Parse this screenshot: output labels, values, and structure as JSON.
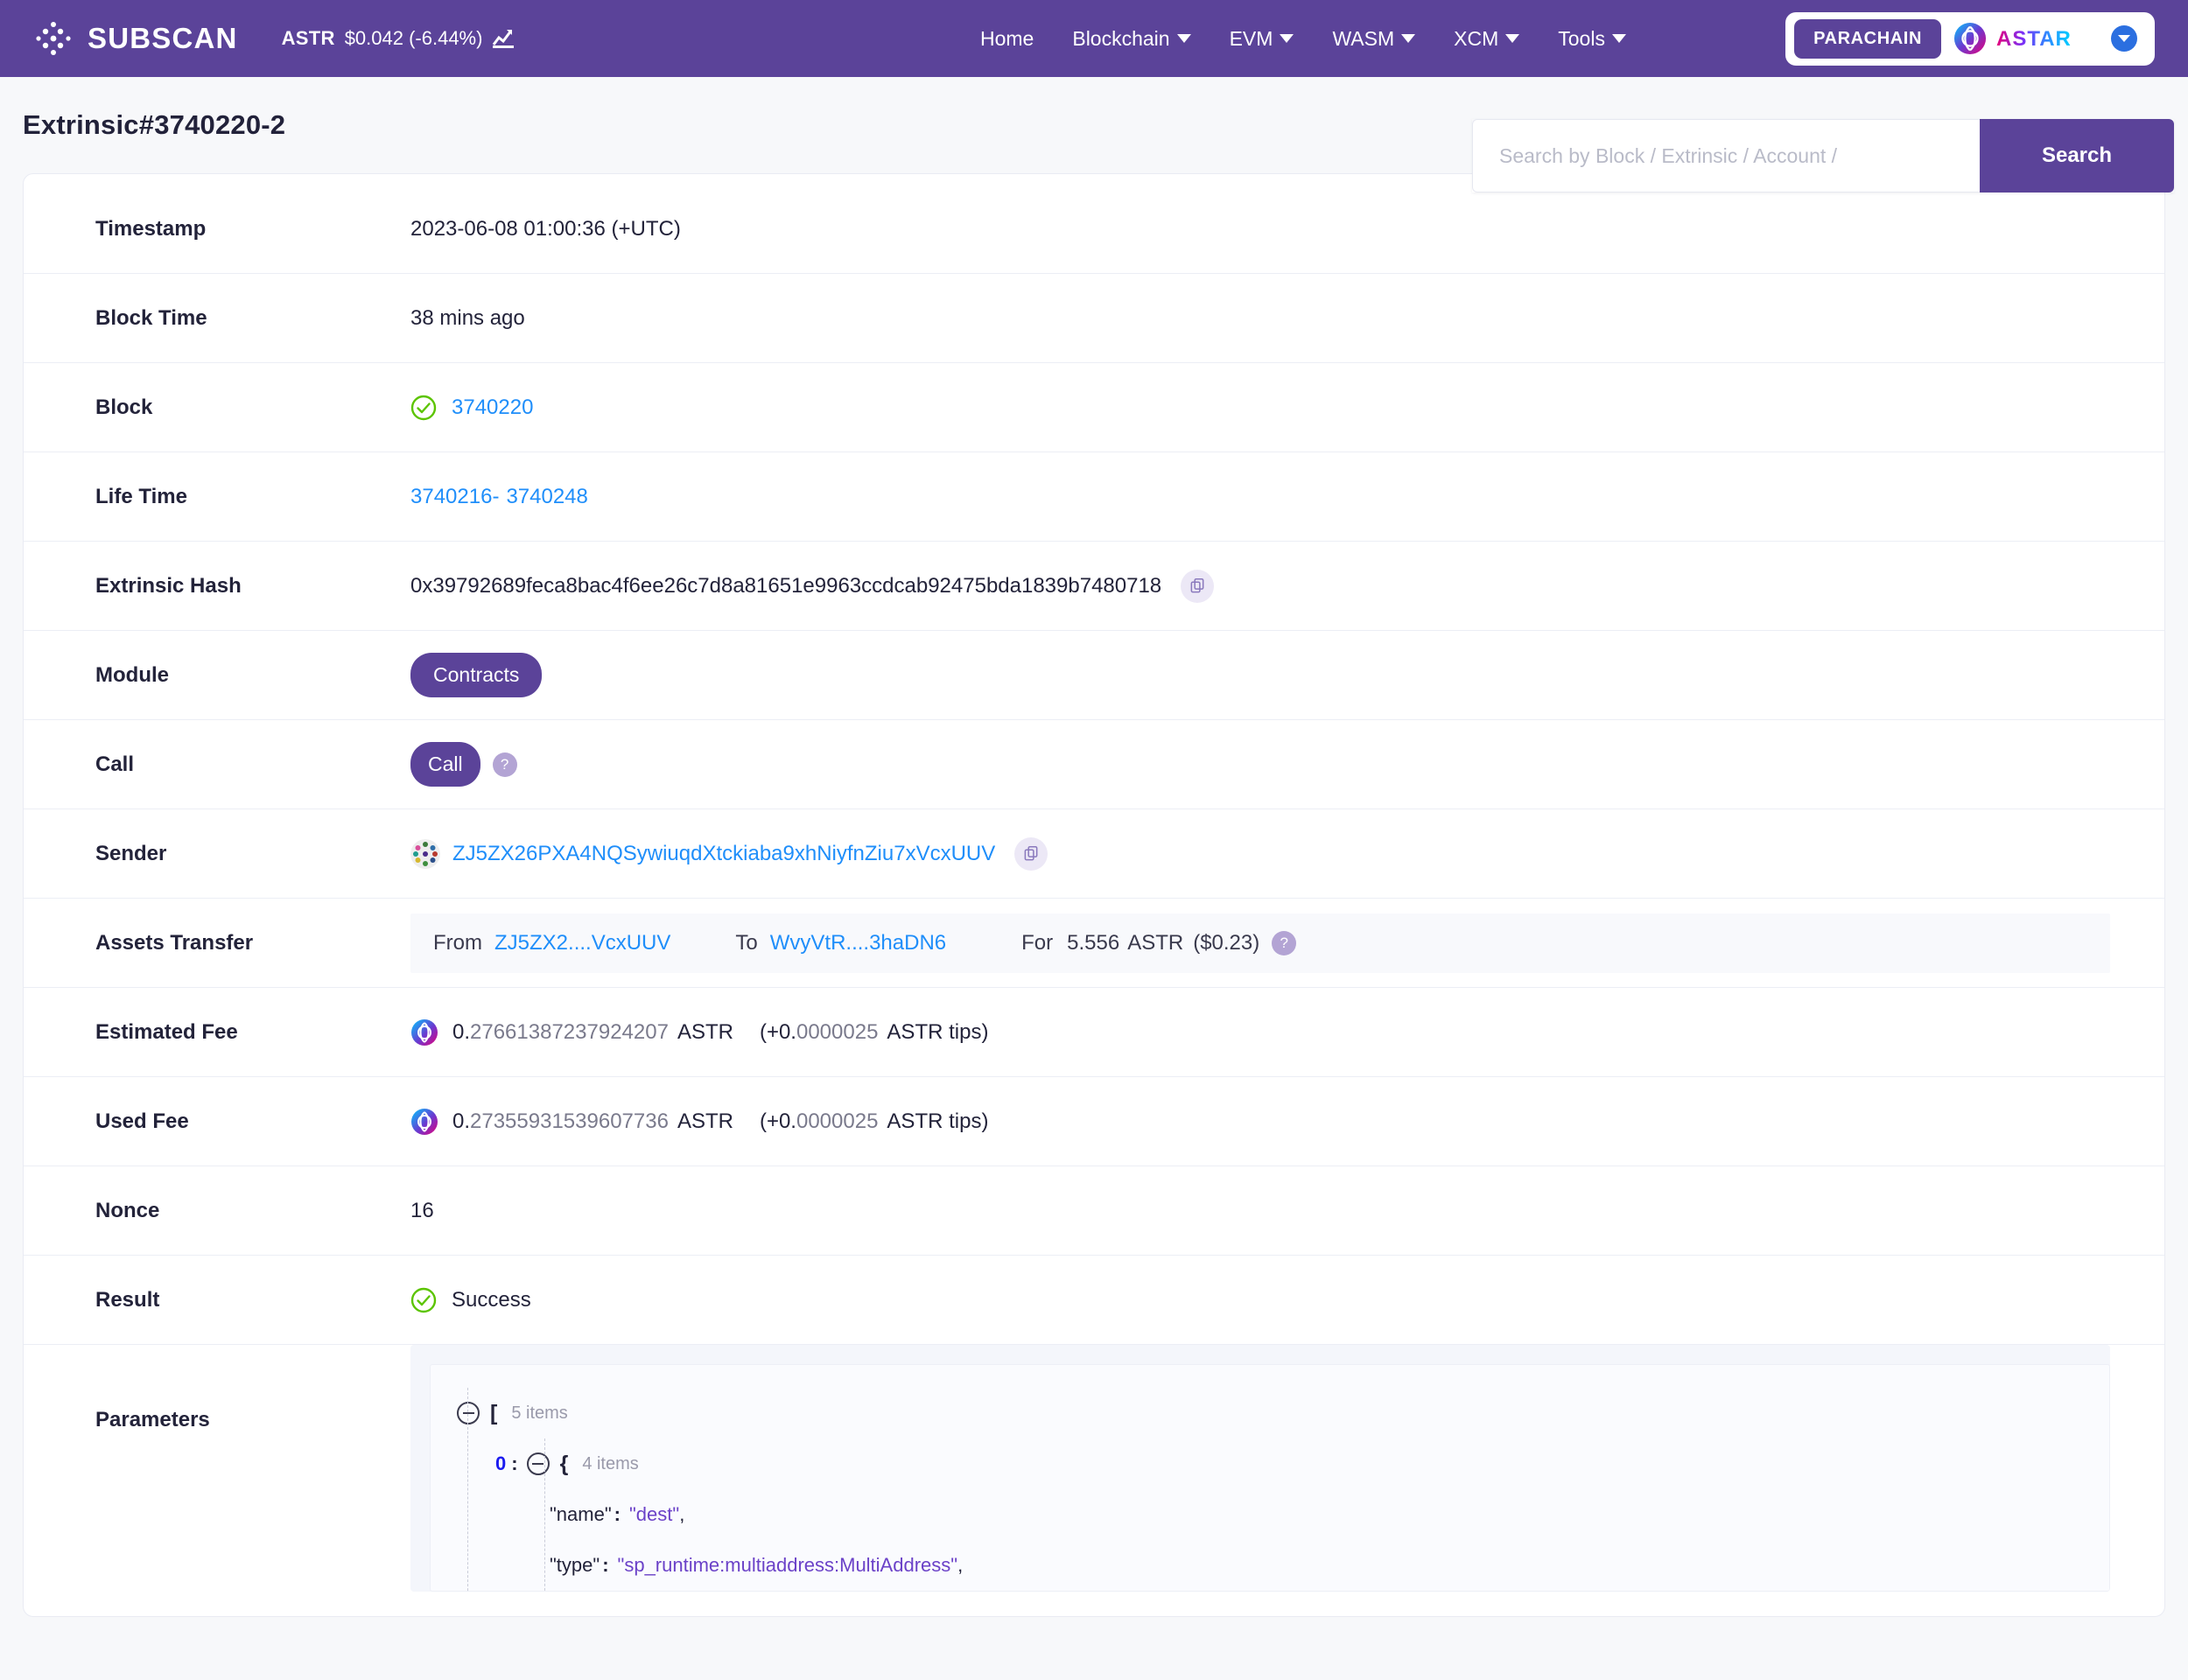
{
  "header": {
    "brand_name": "SUBSCAN",
    "brand_logo_icon": "subscan-diamond-logo",
    "token_symbol": "ASTR",
    "token_price": "$0.042 (-6.44%)",
    "price_chart_icon": "line-chart-icon",
    "nav": [
      {
        "label": "Home",
        "has_caret": false
      },
      {
        "label": "Blockchain",
        "has_caret": true
      },
      {
        "label": "EVM",
        "has_caret": true
      },
      {
        "label": "WASM",
        "has_caret": true
      },
      {
        "label": "XCM",
        "has_caret": true
      },
      {
        "label": "Tools",
        "has_caret": true
      }
    ],
    "parachain_label": "PARACHAIN",
    "chain_name": "ASTAR",
    "chain_logo_icon": "astar-logo-icon",
    "chain_caret_icon": "chevron-down-icon"
  },
  "page": {
    "title": "Extrinsic#3740220-2"
  },
  "search": {
    "placeholder": "Search by Block / Extrinsic / Account /",
    "value": "",
    "button_label": "Search"
  },
  "details": {
    "timestamp_label": "Timestamp",
    "timestamp_value": "2023-06-08 01:00:36 (+UTC)",
    "block_time_label": "Block Time",
    "block_time_value": "38 mins ago",
    "block_label": "Block",
    "block_value": "3740220",
    "block_status_icon": "success-check-icon",
    "life_time_label": "Life Time",
    "life_time_from": "3740216",
    "life_time_sep": "-",
    "life_time_to": "3740248",
    "extrinsic_hash_label": "Extrinsic Hash",
    "extrinsic_hash_value": "0x39792689feca8bac4f6ee26c7d8a81651e9963ccdcab92475bda1839b7480718",
    "copy_icon": "copy-icon",
    "module_label": "Module",
    "module_value": "Contracts",
    "call_label": "Call",
    "call_value": "Call",
    "call_help_icon": "question-mark-icon",
    "sender_label": "Sender",
    "sender_value": "ZJ5ZX26PXA4NQSywiuqdXtckiaba9xhNiyfnZiu7xVcxUUV",
    "sender_identicon": "polkadot-identicon",
    "assets_transfer_label": "Assets Transfer",
    "transfer_from_label": "From",
    "transfer_from_value": "ZJ5ZX2....VcxUUV",
    "transfer_to_label": "To",
    "transfer_to_value": "WvyVtR....3haDN6",
    "transfer_for_label": "For",
    "transfer_amount": "5.556",
    "transfer_unit": "ASTR",
    "transfer_usd": "($0.23)",
    "transfer_help_icon": "question-mark-icon",
    "estimated_fee_label": "Estimated Fee",
    "estimated_fee_int": "0.",
    "estimated_fee_dec": "27661387237924207",
    "estimated_fee_unit": "ASTR",
    "estimated_fee_tip_prefix": "(+0.",
    "estimated_fee_tip_dec": "0000025",
    "estimated_fee_tip_suffix": "ASTR tips)",
    "token_icon": "astr-token-icon",
    "used_fee_label": "Used Fee",
    "used_fee_int": "0.",
    "used_fee_dec": "273559315396077 36",
    "used_fee_dec_clean": "273559315396077",
    "used_fee_full_dec": "27355931539607736",
    "used_fee_unit": "ASTR",
    "used_fee_tip_prefix": "(+0.",
    "used_fee_tip_dec": "0000025",
    "used_fee_tip_suffix": "ASTR tips)",
    "nonce_label": "Nonce",
    "nonce_value": "16",
    "result_label": "Result",
    "result_value": "Success",
    "result_icon": "success-check-icon",
    "parameters_label": "Parameters"
  },
  "parameters_json": {
    "root_bracket": "[",
    "root_count": "5 items",
    "item_index": "0",
    "item_bracket": "{",
    "item_count": "4 items",
    "fields": [
      {
        "key": "\"name\"",
        "colon": ":",
        "value": "\"dest\"",
        "comma": ","
      },
      {
        "key": "\"type\"",
        "colon": ":",
        "value": "\"sp_runtime:multiaddress:MultiAddress\"",
        "comma": ","
      }
    ]
  },
  "colors": {
    "brand_purple": "#5b4399",
    "link_blue": "#1f8efa",
    "success_green": "#5cc400",
    "page_bg": "#f7f8fa",
    "string_purple": "#6b42c8"
  }
}
